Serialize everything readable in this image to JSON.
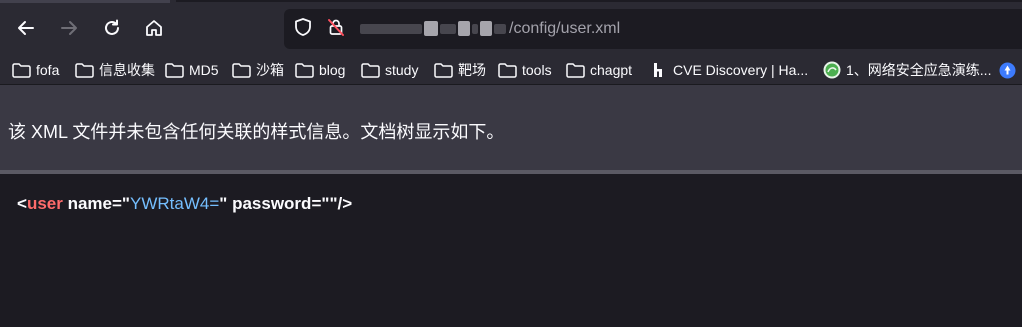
{
  "url": {
    "path": "/config/user.xml"
  },
  "icons": {
    "back": "back-arrow-icon",
    "forward": "forward-arrow-icon",
    "reload": "reload-icon",
    "home": "home-icon",
    "tracking": "shield-icon",
    "insecure": "insecure-lock-icon"
  },
  "bookmarks": [
    {
      "label": "fofa",
      "icon": "folder-icon"
    },
    {
      "label": "信息收集",
      "icon": "folder-icon"
    },
    {
      "label": "MD5",
      "icon": "folder-icon"
    },
    {
      "label": "沙箱",
      "icon": "folder-icon"
    },
    {
      "label": "blog",
      "icon": "folder-icon"
    },
    {
      "label": "study",
      "icon": "folder-icon"
    },
    {
      "label": "靶场",
      "icon": "folder-icon"
    },
    {
      "label": "tools",
      "icon": "folder-icon"
    },
    {
      "label": "chagpt",
      "icon": "folder-icon"
    },
    {
      "label": "CVE Discovery | Ha...",
      "icon": "site-favicon"
    },
    {
      "label": "1、网络安全应急演练...",
      "icon": "site-favicon"
    }
  ],
  "banner": {
    "text": "该 XML 文件并未包含任何关联的样式信息。文档树显示如下。"
  },
  "xml": {
    "open": "<",
    "tag": "user",
    "attr1_name": " name",
    "attr1_eq": "=\"",
    "attr1_value": "YWRtaW4=",
    "attr1_close": "\"",
    "attr2_name": " password",
    "attr2_eq": "=\"",
    "attr2_value": "",
    "attr2_close": "\"",
    "end": "/>"
  },
  "colors": {
    "chrome": "#2b2a33",
    "page_bg": "#1c1b22",
    "banner_bg": "#3a3944",
    "tag": "#ff6b6b",
    "attr_value": "#75bfff",
    "text": "#fbfbfe"
  }
}
